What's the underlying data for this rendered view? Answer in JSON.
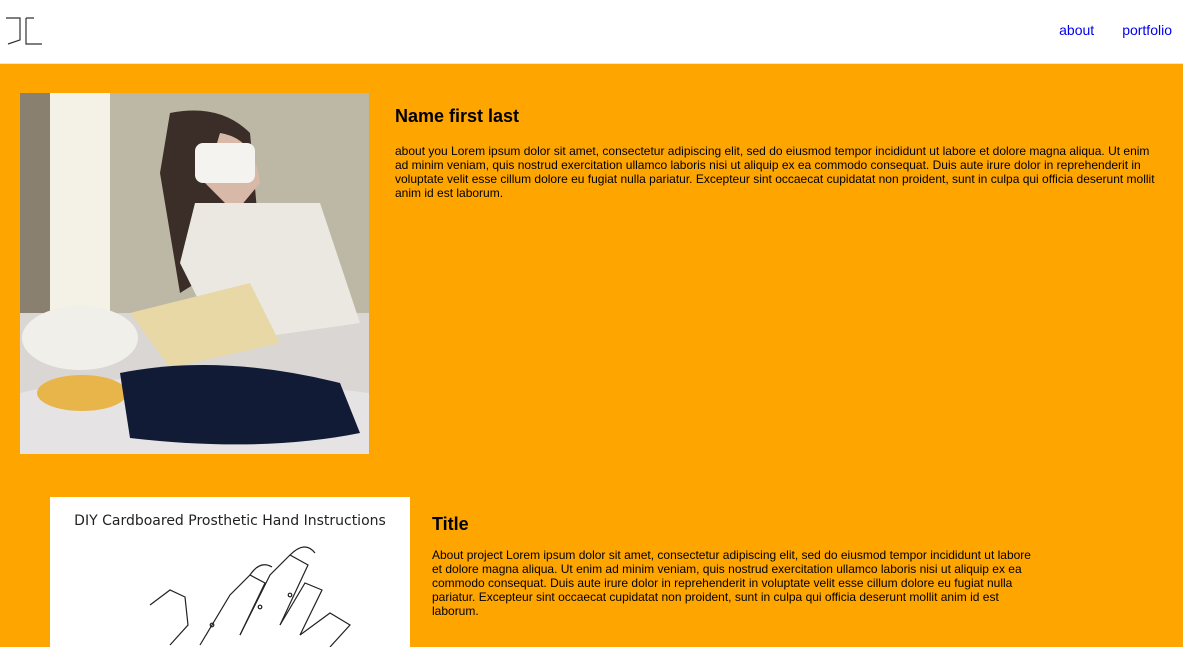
{
  "header": {
    "logo_icon": "jc-monogram-icon",
    "nav": [
      {
        "label": "about"
      },
      {
        "label": "portfolio"
      }
    ],
    "link_color": "#0000ee"
  },
  "colors": {
    "page_background": "#fea500",
    "header_background": "#ffffff"
  },
  "profile": {
    "name": "Name first last",
    "about": "about you Lorem ipsum dolor sit amet, consectetur adipiscing elit, sed do eiusmod tempor incididunt ut labore et dolore magna aliqua. Ut enim ad minim veniam, quis nostrud exercitation ullamco laboris nisi ut aliquip ex ea commodo consequat. Duis aute irure dolor in reprehenderit in voluptate velit esse cillum dolore eu fugiat nulla pariatur. Excepteur sint occaecat cupidatat non proident, sunt in culpa qui officia deserunt mollit anim id est laborum."
  },
  "project": {
    "image_caption": "DIY Cardboared Prosthetic Hand Instructions",
    "title": "Title",
    "about": "About project Lorem ipsum dolor sit amet, consectetur adipiscing elit, sed do eiusmod tempor incididunt ut labore et dolore magna aliqua. Ut enim ad minim veniam, quis nostrud exercitation ullamco laboris nisi ut aliquip ex ea commodo consequat. Duis aute irure dolor in reprehenderit in voluptate velit esse cillum dolore eu fugiat nulla pariatur. Excepteur sint occaecat cupidatat non proident, sunt in culpa qui officia deserunt mollit anim id est laborum."
  }
}
